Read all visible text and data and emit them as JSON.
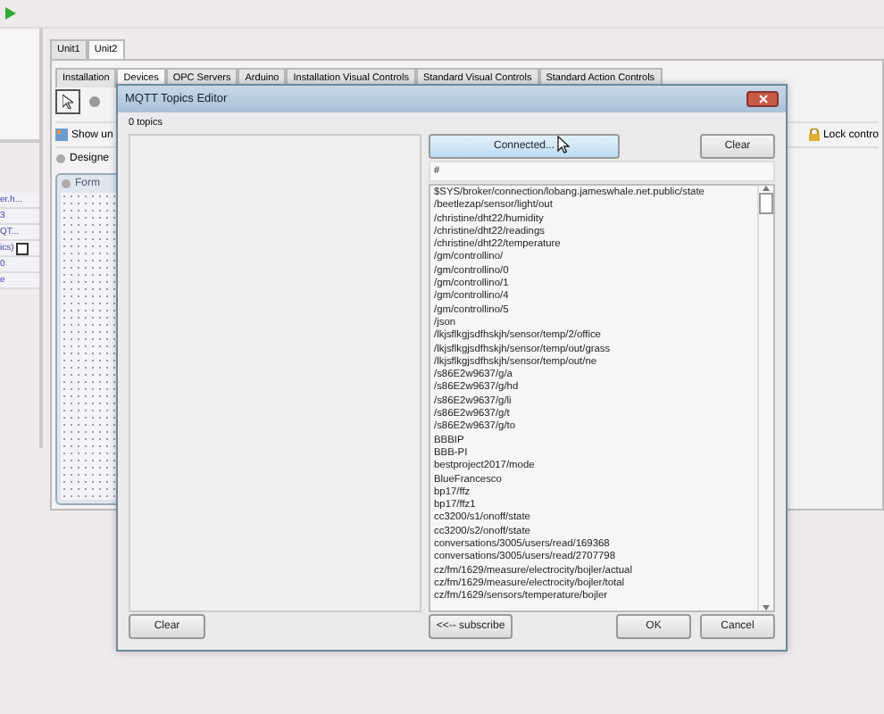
{
  "unit_tabs": [
    {
      "label": "Unit1",
      "selected": false
    },
    {
      "label": "Unit2",
      "selected": true
    }
  ],
  "palette_tabs": [
    {
      "label": "Installation",
      "selected": false
    },
    {
      "label": "Devices",
      "selected": true
    },
    {
      "label": "OPC Servers",
      "selected": false
    },
    {
      "label": "Arduino",
      "selected": false
    },
    {
      "label": "Installation Visual Controls",
      "selected": false
    },
    {
      "label": "Standard Visual Controls",
      "selected": false
    },
    {
      "label": "Standard Action Controls",
      "selected": false
    }
  ],
  "designer_toolbar": {
    "show_button": "Show un",
    "lock_button": "Lock contro"
  },
  "designer_tab": "Designe",
  "form_title": "Form",
  "properties": [
    "er.h...",
    "3",
    "QT...",
    "ics)",
    "0",
    "e"
  ],
  "dialog": {
    "title": "MQTT Topics Editor",
    "topic_count": "0 topics",
    "connect_button": "Connected...",
    "clear_top": "Clear",
    "filter": "#",
    "topics": [
      "$SYS/broker/connection/lobang.jameswhale.net.public/state",
      "/beetlezap/sensor/light/out",
      "/christine/dht22/humidity",
      "/christine/dht22/readings",
      "/christine/dht22/temperature",
      "/gm/controllino/",
      "/gm/controllino/0",
      "/gm/controllino/1",
      "/gm/controllino/4",
      "/gm/controllino/5",
      "/json",
      "/lkjsflkgjsdfhskjh/sensor/temp/2/office",
      "/lkjsflkgjsdfhskjh/sensor/temp/out/grass",
      "/lkjsflkgjsdfhskjh/sensor/temp/out/ne",
      "/s86E2w9637/g/a",
      "/s86E2w9637/g/hd",
      "/s86E2w9637/g/li",
      "/s86E2w9637/g/t",
      "/s86E2w9637/g/to",
      "BBBIP",
      "BBB-PI",
      "bestproject2017/mode",
      "BlueFrancesco",
      "bp17/ffz",
      "bp17/ffz1",
      "cc3200/s1/onoff/state",
      "cc3200/s2/onoff/state",
      "conversations/3005/users/read/169368",
      "conversations/3005/users/read/2707798",
      "cz/fm/1629/measure/electrocity/bojler/actual",
      "cz/fm/1629/measure/electrocity/bojler/total",
      "cz/fm/1629/sensors/temperature/bojler"
    ],
    "clear_bottom": "Clear",
    "subscribe_button": "<<-- subscribe",
    "ok_button": "OK",
    "cancel_button": "Cancel"
  }
}
